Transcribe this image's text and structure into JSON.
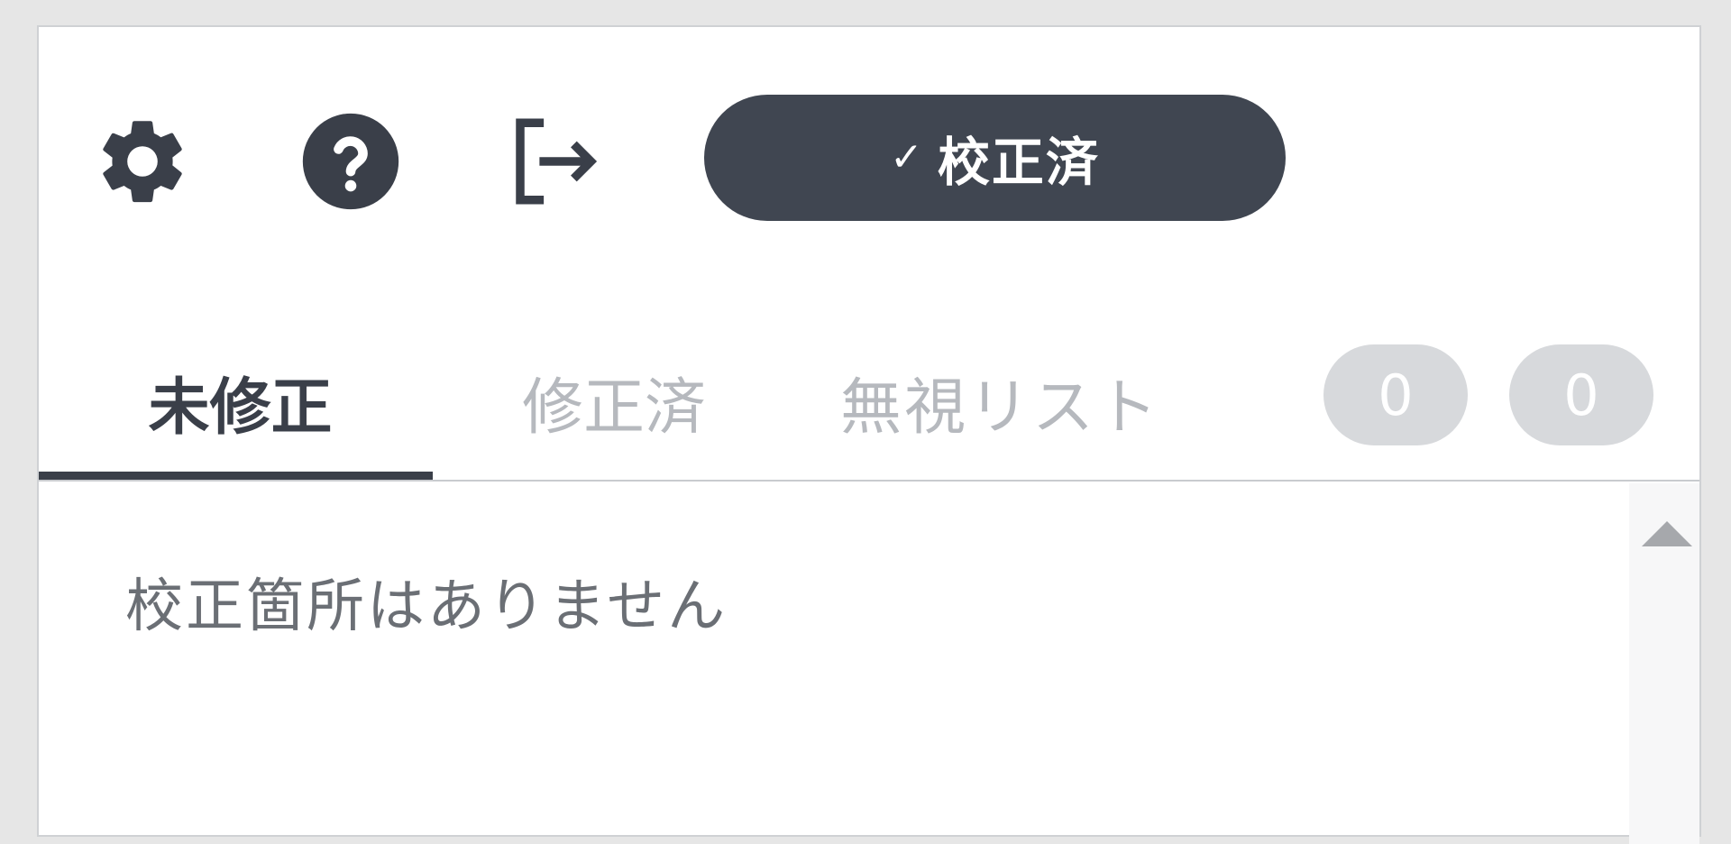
{
  "toolbar": {
    "icons": [
      "gear-icon",
      "help-icon",
      "logout-icon"
    ],
    "status": {
      "check": "✓",
      "label": "校正済"
    }
  },
  "tabs": [
    {
      "label": "未修正",
      "active": true
    },
    {
      "label": "修正済",
      "active": false
    },
    {
      "label": "無視リスト",
      "active": false
    }
  ],
  "counts": [
    "0",
    "0"
  ],
  "content": {
    "empty_message": "校正箇所はありません"
  },
  "colors": {
    "accent": "#404651",
    "inactive_tab": "#b6b9be",
    "badge": "#d7d9dc"
  }
}
